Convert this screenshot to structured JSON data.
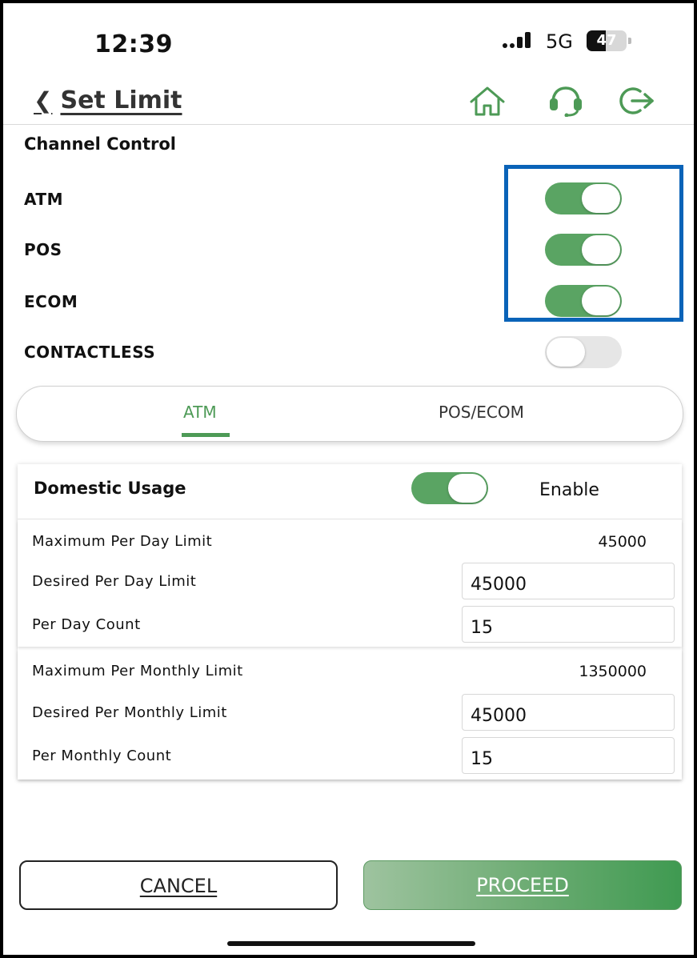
{
  "status_bar": {
    "time": "12:39",
    "network": "5G",
    "battery": "47",
    "battery_level": 0.47
  },
  "header": {
    "back_label": "Set Limit",
    "icons": [
      "home-icon",
      "headset-icon",
      "logout-icon"
    ],
    "accent": "#4d9a56"
  },
  "channel_control": {
    "title": "Channel Control",
    "items": [
      {
        "label": "ATM",
        "enabled": true
      },
      {
        "label": "POS",
        "enabled": true
      },
      {
        "label": "ECOM",
        "enabled": true
      },
      {
        "label": "CONTACTLESS",
        "enabled": false
      }
    ],
    "highlight_color": "#0a63b8"
  },
  "tabs": [
    {
      "label": "ATM",
      "active": true
    },
    {
      "label": "POS/ECOM",
      "active": false
    }
  ],
  "domestic": {
    "title": "Domestic Usage",
    "toggle_enabled": true,
    "toggle_label": "Enable",
    "daily": {
      "max_label": "Maximum Per Day Limit",
      "max_value": "45000",
      "desired_label": "Desired Per Day Limit",
      "desired_value": "45000",
      "count_label": "Per Day Count",
      "count_value": "15"
    },
    "monthly": {
      "max_label": "Maximum Per Monthly Limit",
      "max_value": "1350000",
      "desired_label": "Desired Per Monthly Limit",
      "desired_value": "45000",
      "count_label": "Per Monthly Count",
      "count_value": "15"
    }
  },
  "buttons": {
    "cancel": "CANCEL",
    "proceed": "PROCEED"
  }
}
